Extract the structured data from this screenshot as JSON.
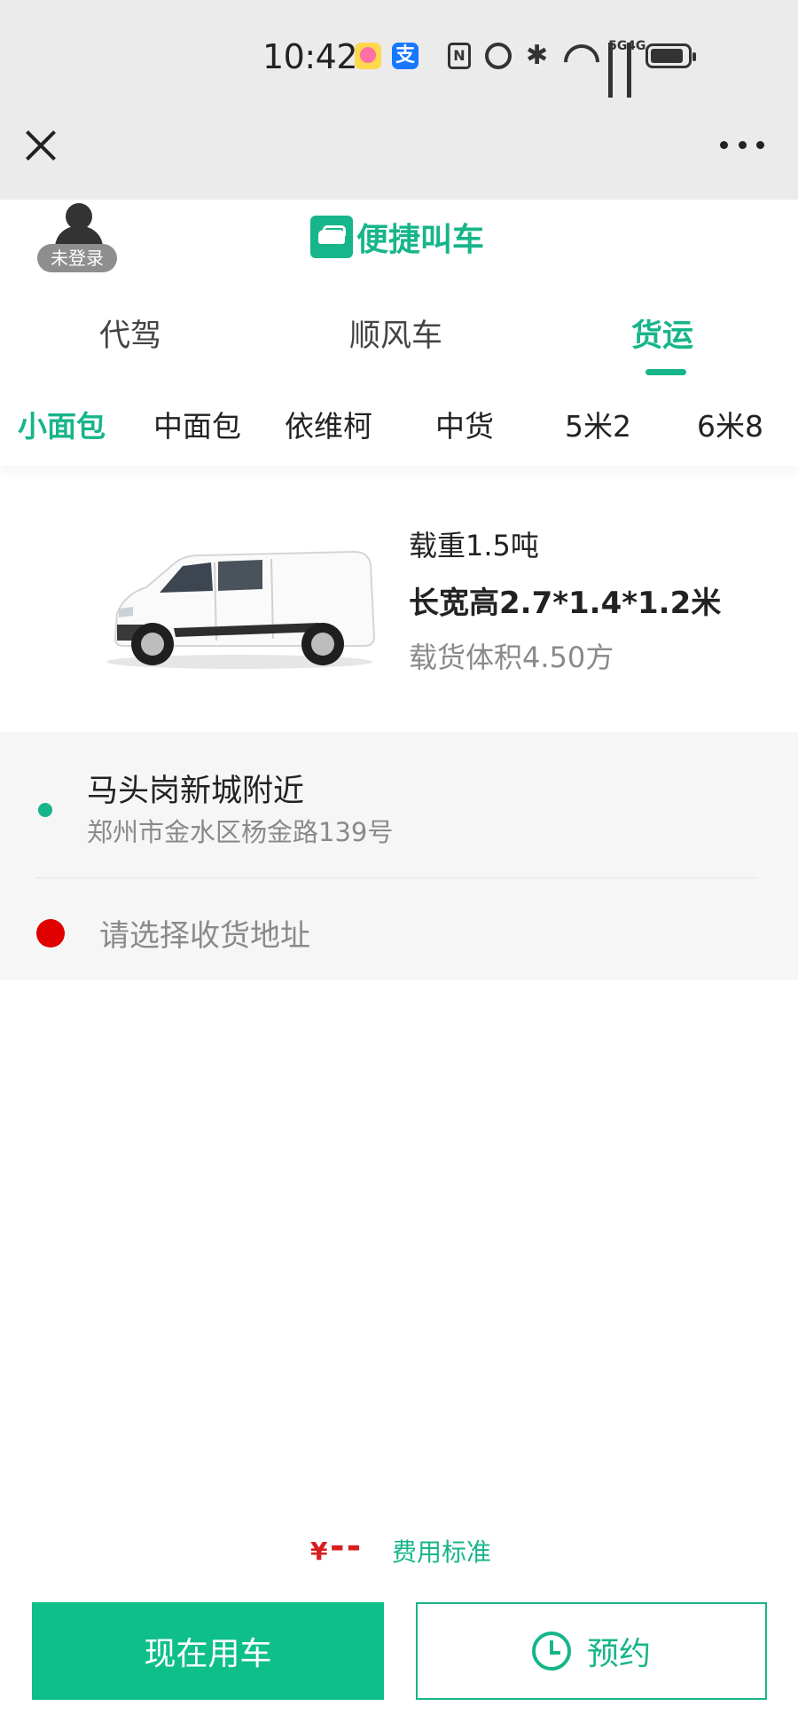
{
  "status_bar": {
    "time": "10:42",
    "icons": [
      "app-icon-pink",
      "alipay-icon",
      "nfc-icon",
      "alarm-icon",
      "bluetooth-icon",
      "wifi-icon",
      "signal-5g-icon",
      "signal-4g-icon",
      "battery-icon"
    ],
    "alipay_glyph": "支",
    "nfc_glyph": "N",
    "bt_glyph": "✱",
    "sig1_label": "5G",
    "sig2_label": "4G"
  },
  "title_bar": {
    "close_icon": "close-icon",
    "more_icon": "more-icon"
  },
  "header": {
    "login_badge": "未登录",
    "brand_title": "便捷叫车"
  },
  "service_tabs": [
    {
      "label": "代驾",
      "active": false
    },
    {
      "label": "顺风车",
      "active": false
    },
    {
      "label": "货运",
      "active": true
    }
  ],
  "vehicle_tabs": [
    {
      "label": "小面包",
      "active": true
    },
    {
      "label": "中面包",
      "active": false
    },
    {
      "label": "依维柯",
      "active": false
    },
    {
      "label": "中货",
      "active": false
    },
    {
      "label": "5米2",
      "active": false
    },
    {
      "label": "6米8",
      "active": false
    }
  ],
  "vehicle_info": {
    "load": "载重1.5吨",
    "dimensions": "长宽高2.7*1.4*1.2米",
    "volume": "载货体积4.50方"
  },
  "address": {
    "pickup_title": "马头岗新城附近",
    "pickup_detail": "郑州市金水区杨金路139号",
    "dropoff_placeholder": "请选择收货地址"
  },
  "price": {
    "symbol": "¥",
    "value": "--",
    "fee_link": "费用标准"
  },
  "actions": {
    "now_label": "现在用车",
    "reserve_label": "预约"
  },
  "colors": {
    "accent": "#17b58a",
    "primary_button": "#0fbf8a",
    "price": "#d81e1e",
    "dropoff_dot": "#e00000",
    "chrome_bg": "#ebebeb"
  }
}
